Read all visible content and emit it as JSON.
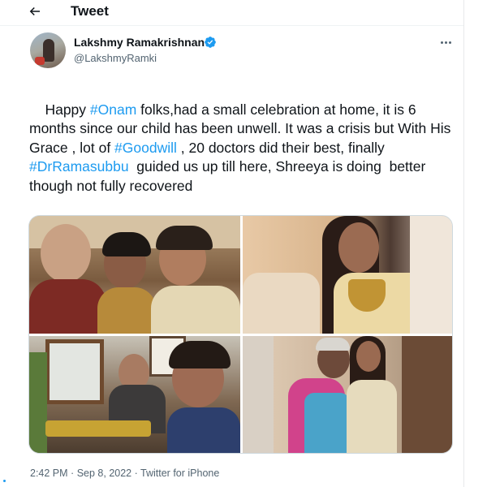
{
  "header": {
    "title": "Tweet",
    "back_icon": "arrow-left-icon"
  },
  "author": {
    "name": "Lakshmy Ramakrishnan",
    "handle": "@LakshmyRamki",
    "verified": true
  },
  "tweet": {
    "segments": [
      {
        "text": "Happy ",
        "type": "text"
      },
      {
        "text": "#Onam",
        "type": "hashtag"
      },
      {
        "text": " folks,had a small celebration at home, it is 6 months since our child has been unwell. It was a crisis but With His Grace , lot of ",
        "type": "text"
      },
      {
        "text": "#Goodwill",
        "type": "hashtag"
      },
      {
        "text": " , 20 doctors did their best, finally ",
        "type": "text"
      },
      {
        "text": "#DrRamasubbu",
        "type": "hashtag"
      },
      {
        "text": "  guided us up till here, Shreeya is doing  better though not fully recovered",
        "type": "text"
      }
    ]
  },
  "meta": {
    "time": "2:42 PM",
    "separator": "·",
    "date": "Sep 8, 2022",
    "source": "Twitter for iPhone"
  },
  "colors": {
    "accent": "#1d9bf0",
    "text_primary": "#0f1419",
    "text_secondary": "#536471",
    "border": "#cfd9de"
  }
}
